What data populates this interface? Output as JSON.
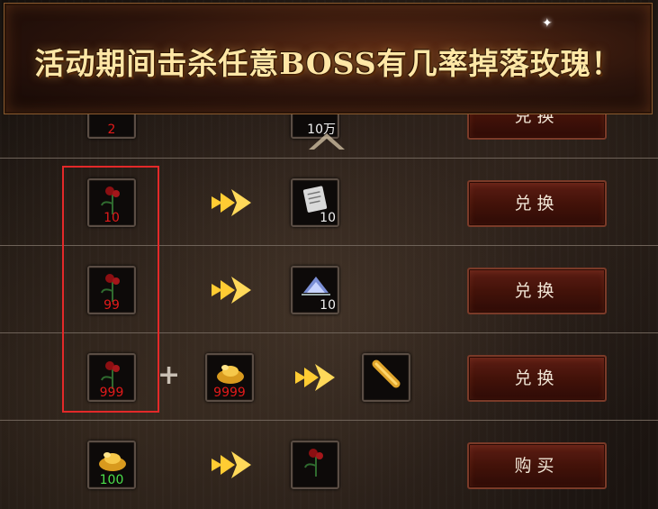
{
  "banner": {
    "title": "活动期间击杀任意BOSS有几率掉落玫瑰！"
  },
  "rows": [
    {
      "cost_qty": "2",
      "reward_qty": "10万",
      "button": "兑换"
    },
    {
      "cost_qty": "10",
      "reward_qty": "10",
      "button": "兑换"
    },
    {
      "cost_qty": "99",
      "reward_qty": "10",
      "button": "兑换"
    },
    {
      "cost_qty": "999",
      "extra_qty": "9999",
      "button": "兑换"
    },
    {
      "cost_qty": "100",
      "button": "购买"
    }
  ],
  "icons": {
    "rose": "rose-icon",
    "gold": "gold-ingot-icon",
    "scroll": "scroll-icon",
    "crystal": "crystal-ship-icon",
    "golden_scroll": "golden-scroll-icon",
    "arrow": "double-arrow-icon"
  },
  "colors": {
    "qty_red": "#e21a1a",
    "qty_green": "#4be04b",
    "highlight": "#e32929",
    "arrow": "#ffcc33"
  }
}
